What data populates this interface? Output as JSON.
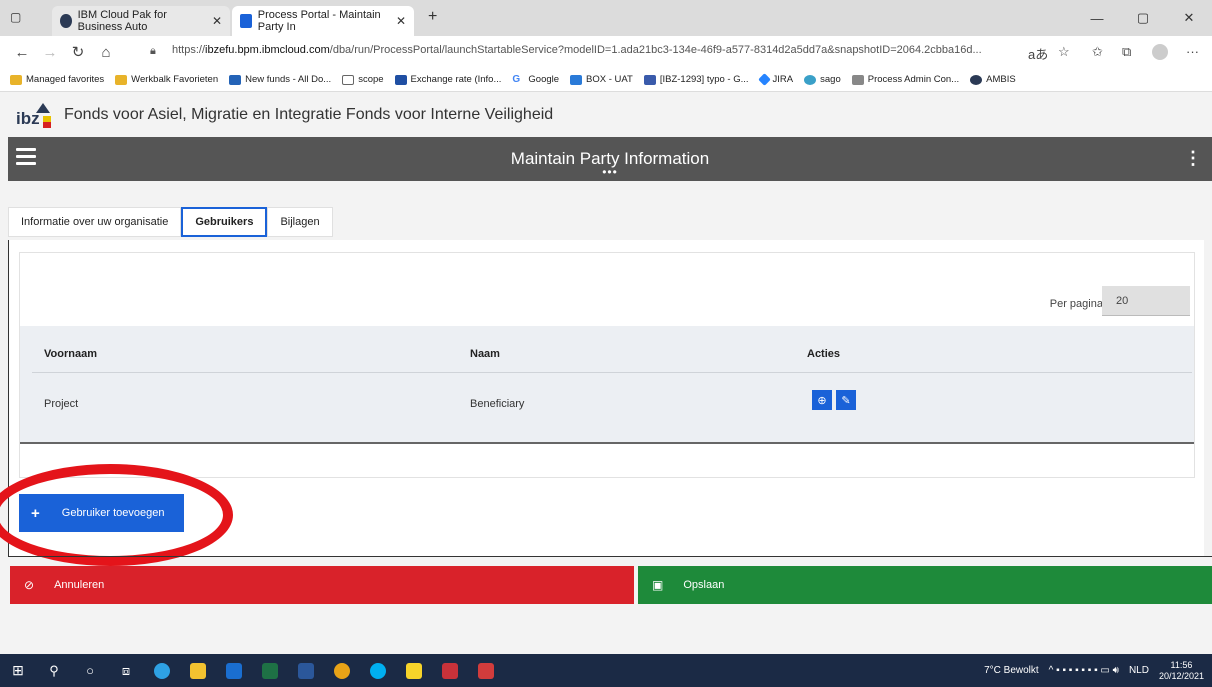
{
  "browser": {
    "tabs": [
      {
        "label": "IBM Cloud Pak for Business Auto",
        "active": false
      },
      {
        "label": "Process Portal - Maintain Party In",
        "active": true
      }
    ],
    "url_prefix": "https://",
    "url_host": "ibzefu.bpm.ibmcloud.com",
    "url_path": "/dba/run/ProcessPortal/launchStartableService?modelID=1.ada21bc3-134e-46f9-a577-8314d2a5dd7a&snapshotID=2064.2cbba16d...",
    "favorites": [
      {
        "label": "Managed favorites",
        "color": "#e8b32a"
      },
      {
        "label": "Werkbalk Favorieten",
        "color": "#e8b32a"
      },
      {
        "label": "New funds - All Do...",
        "color": "#2463b7"
      },
      {
        "label": "scope",
        "color": "#666666"
      },
      {
        "label": "Exchange rate (Info...",
        "color": "#1f4fa3"
      },
      {
        "label": "Google",
        "color": "#4285f4"
      },
      {
        "label": "BOX - UAT",
        "color": "#2a7ad8"
      },
      {
        "label": "[IBZ-1293] typo - G...",
        "color": "#3a5bab"
      },
      {
        "label": "JIRA",
        "color": "#2684ff"
      },
      {
        "label": "sago",
        "color": "#3aa0c8"
      },
      {
        "label": "Process Admin Con...",
        "color": "#888888"
      },
      {
        "label": "AMBIS",
        "color": "#2b3a55"
      }
    ]
  },
  "app": {
    "org_name": "Fonds voor Asiel, Migratie en Integratie Fonds voor Interne Veiligheid",
    "page_title": "Maintain Party Information",
    "tabs": [
      {
        "label": "Informatie over uw organisatie",
        "selected": false
      },
      {
        "label": "Gebruikers",
        "selected": true
      },
      {
        "label": "Bijlagen",
        "selected": false
      }
    ],
    "per_page_label": "Per pagina:",
    "per_page_value": "20",
    "columns": [
      "Voornaam",
      "Naam",
      "Acties"
    ],
    "rows": [
      {
        "voornaam": "Project",
        "naam": "Beneficiary"
      }
    ],
    "add_user_label": "Gebruiker toevoegen",
    "cancel_label": "Annuleren",
    "save_label": "Opslaan"
  },
  "taskbar": {
    "weather": "7°C Bewolkt",
    "language": "NLD",
    "time": "11:56",
    "date": "20/12/2021"
  },
  "colors": {
    "primary": "#1a62d8",
    "danger": "#d9222a",
    "success": "#1e8a3a",
    "header": "#555555",
    "annotation": "#e4141a"
  }
}
